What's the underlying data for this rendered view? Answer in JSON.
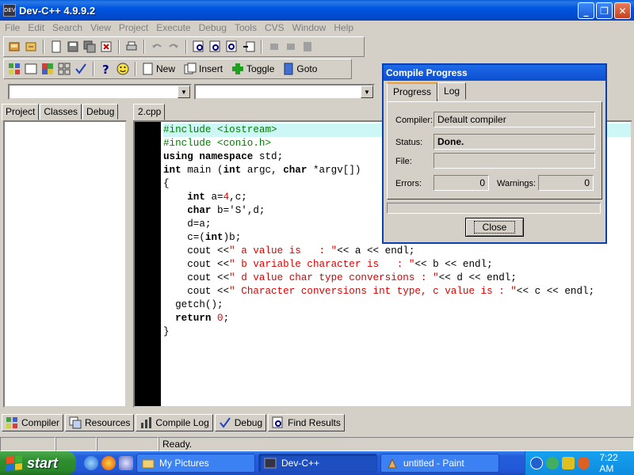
{
  "window": {
    "title": "Dev-C++ 4.9.9.2",
    "app_icon_label": "DEV",
    "minimize": "_",
    "maximize": "❐",
    "close": "✕"
  },
  "menu": [
    "File",
    "Edit",
    "Search",
    "View",
    "Project",
    "Execute",
    "Debug",
    "Tools",
    "CVS",
    "Window",
    "Help"
  ],
  "toolbar2": {
    "new_label": "New",
    "insert_label": "Insert",
    "toggle_label": "Toggle",
    "goto_label": "Goto"
  },
  "left_tabs": [
    "Project",
    "Classes",
    "Debug"
  ],
  "editor_tab": "2.cpp",
  "code_lines": [
    [
      {
        "t": "pp",
        "v": "#include <iostream>"
      }
    ],
    [
      {
        "t": "pp",
        "v": "#include <conio.h>"
      }
    ],
    [
      {
        "t": "kw",
        "v": "using namespace"
      },
      {
        "t": "",
        "v": " std;"
      }
    ],
    [
      {
        "t": "kw",
        "v": "int"
      },
      {
        "t": "",
        "v": " main ("
      },
      {
        "t": "kw",
        "v": "int"
      },
      {
        "t": "",
        "v": " argc, "
      },
      {
        "t": "kw",
        "v": "char"
      },
      {
        "t": "",
        "v": " *argv[])"
      }
    ],
    [
      {
        "t": "",
        "v": "{"
      }
    ],
    [
      {
        "t": "",
        "v": "    "
      },
      {
        "t": "kw",
        "v": "int"
      },
      {
        "t": "",
        "v": " a="
      },
      {
        "t": "num",
        "v": "4"
      },
      {
        "t": "",
        "v": ",c;"
      }
    ],
    [
      {
        "t": "",
        "v": "    "
      },
      {
        "t": "kw",
        "v": "char"
      },
      {
        "t": "",
        "v": " b='S',d;"
      }
    ],
    [
      {
        "t": "",
        "v": "    d=a;"
      }
    ],
    [
      {
        "t": "",
        "v": "    c=("
      },
      {
        "t": "kw",
        "v": "int"
      },
      {
        "t": "",
        "v": ")b;"
      }
    ],
    [
      {
        "t": "",
        "v": "    cout <<"
      },
      {
        "t": "str",
        "v": "\" a value is   : \""
      },
      {
        "t": "",
        "v": "<< a << endl;"
      }
    ],
    [
      {
        "t": "",
        "v": "    cout <<"
      },
      {
        "t": "str",
        "v": "\" b variable character is   : \""
      },
      {
        "t": "",
        "v": "<< b << endl;"
      }
    ],
    [
      {
        "t": "",
        "v": "    cout <<"
      },
      {
        "t": "str",
        "v": "\" d value char type conversions : \""
      },
      {
        "t": "",
        "v": "<< d << endl;"
      }
    ],
    [
      {
        "t": "",
        "v": "    cout <<"
      },
      {
        "t": "str",
        "v": "\" Character conversions int type, c value is : \""
      },
      {
        "t": "",
        "v": "<< c << endl;"
      }
    ],
    [
      {
        "t": "",
        "v": "  getch();"
      }
    ],
    [
      {
        "t": "",
        "v": "  "
      },
      {
        "t": "kw",
        "v": "return"
      },
      {
        "t": "",
        "v": " "
      },
      {
        "t": "num",
        "v": "0"
      },
      {
        "t": "",
        "v": ";"
      }
    ],
    [
      {
        "t": "",
        "v": "}"
      }
    ]
  ],
  "dialog": {
    "title": "Compile Progress",
    "tabs": [
      "Progress",
      "Log"
    ],
    "compiler_label": "Compiler:",
    "compiler_value": "Default compiler",
    "status_label": "Status:",
    "status_value": "Done.",
    "file_label": "File:",
    "file_value": "",
    "errors_label": "Errors:",
    "errors_value": "0",
    "warnings_label": "Warnings:",
    "warnings_value": "0",
    "close_label": "Close"
  },
  "bottom_tabs": [
    "Compiler",
    "Resources",
    "Compile Log",
    "Debug",
    "Find Results"
  ],
  "status": {
    "text": "Ready."
  },
  "taskbar": {
    "start_label": "start",
    "items": [
      "My Pictures",
      "Dev-C++",
      "untitled - Paint"
    ],
    "active_index": 1,
    "clock": "7:22 AM"
  }
}
